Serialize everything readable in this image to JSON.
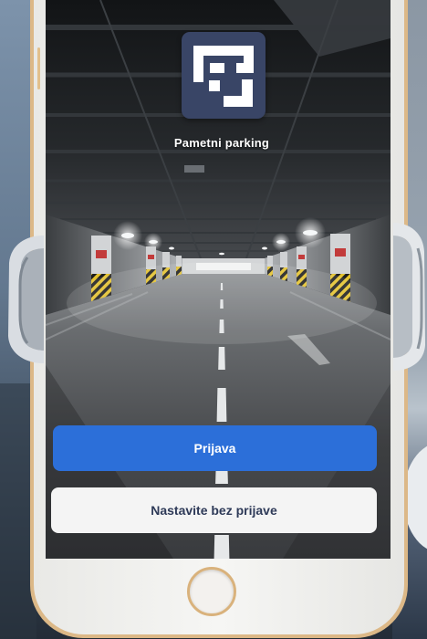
{
  "app": {
    "title": "Pametni parking"
  },
  "buttons": {
    "login": "Prijava",
    "continue_without_login": "Nastavite bez prijave"
  },
  "icons": {
    "logo": "parking-logo-icon",
    "home_button": "home-button-icon"
  },
  "colors": {
    "primary_button": "#2c6fd9",
    "secondary_button": "#f4f4f4",
    "secondary_button_text": "#2e3a58",
    "logo_background": "#394566",
    "phone_trim": "#d9b27c"
  }
}
